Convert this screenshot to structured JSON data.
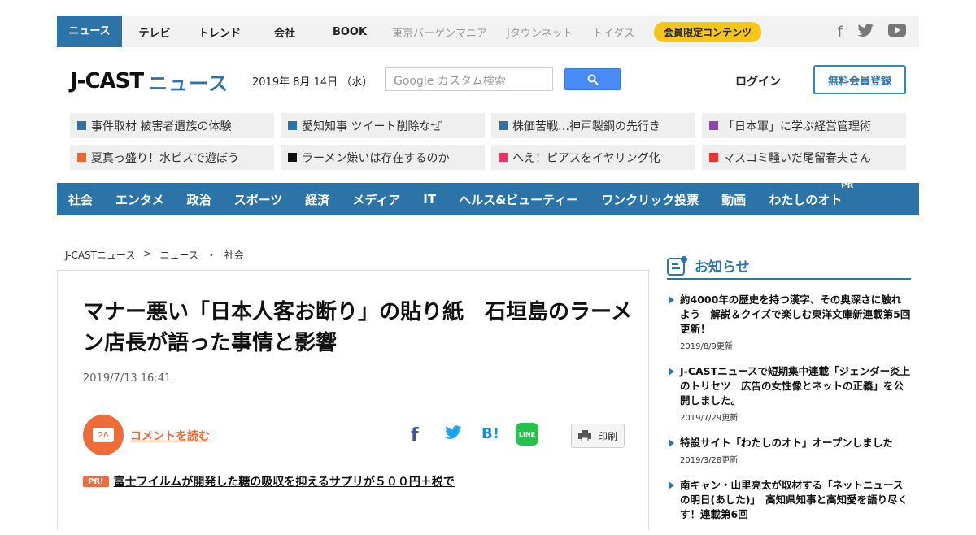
{
  "topnav": {
    "items": [
      {
        "label": "ニュース",
        "style": "active"
      },
      {
        "label": "テレビ",
        "style": "plain"
      },
      {
        "label": "トレンド",
        "style": "plain"
      },
      {
        "label": "会社",
        "style": "plain"
      },
      {
        "label": "BOOK",
        "style": "book"
      },
      {
        "label": "東京バーゲンマニア",
        "style": "gray"
      },
      {
        "label": "Jタウンネット",
        "style": "gray"
      },
      {
        "label": "トイダス",
        "style": "gray"
      }
    ],
    "member_badge": "会員限定コンテンツ",
    "social": [
      {
        "icon": "facebook-icon",
        "glyph": "f"
      },
      {
        "icon": "twitter-icon",
        "glyph": "🐦"
      },
      {
        "icon": "youtube-icon",
        "glyph": "▶"
      }
    ]
  },
  "header": {
    "logo_jcast": "J-CAST",
    "logo_news": "ニュース",
    "date": "2019年 8月 14日 （水）",
    "search_placeholder": "Google カスタム検索",
    "login_label": "ログイン",
    "register_label": "無料会員登録"
  },
  "topics": [
    {
      "label": "事件取材 被害者遺族の体験",
      "color": "#2c74a8"
    },
    {
      "label": "愛知知事 ツイート削除なぜ",
      "color": "#2c74a8"
    },
    {
      "label": "株価苦戦…神戸製鋼の先行き",
      "color": "#2c74a8"
    },
    {
      "label": "「日本軍」に学ぶ経営管理術",
      "color": "#8e44ad"
    },
    {
      "label": "夏真っ盛り！水ピスで遊ぼう",
      "color": "#f0662e"
    },
    {
      "label": "ラーメン嫌いは存在するのか",
      "color": "#111111"
    },
    {
      "label": "へえ！ピアスをイヤリング化",
      "color": "#e8336b"
    },
    {
      "label": "マスコミ騒いだ尾留春夫さん",
      "color": "#e8332e"
    }
  ],
  "categories": [
    {
      "label": "社会",
      "pr": false
    },
    {
      "label": "エンタメ",
      "pr": false
    },
    {
      "label": "政治",
      "pr": false
    },
    {
      "label": "スポーツ",
      "pr": false
    },
    {
      "label": "経済",
      "pr": false
    },
    {
      "label": "メディア",
      "pr": false
    },
    {
      "label": "IT",
      "pr": false
    },
    {
      "label": "ヘルス&ビューティー",
      "pr": false
    },
    {
      "label": "ワンクリック投票",
      "pr": false
    },
    {
      "label": "動画",
      "pr": false
    },
    {
      "label": "わたしのオト",
      "pr": true
    }
  ],
  "pr_tag": "PR",
  "breadcrumb": {
    "home": "J-CASTニュース",
    "sep1": ">",
    "section": "ニュース",
    "sep2": "・",
    "category": "社会"
  },
  "article": {
    "headline": "マナー悪い「日本人客お断り」の貼り紙　石垣島のラーメン店長が語った事情と影響",
    "date": "2019/7/13 16:41",
    "comment_count": "26",
    "comment_label": "コメントを読む",
    "share": {
      "facebook": "f",
      "hatena": "B!",
      "line": "LINE"
    },
    "print_label": "印刷",
    "pr_badge": "PR!",
    "pr_link": "富士フイルムが開発した糖の吸収を抑えるサプリが５００円＋税で"
  },
  "sidebar": {
    "title": "お知らせ",
    "items": [
      {
        "text": "約4000年の歴史を持つ漢字、その奥深さに触れよう　解説＆クイズで楽しむ東洋文庫新連載第5回更新！",
        "date": "2019/8/9更新"
      },
      {
        "text": "J-CASTニュースで短期集中連載「ジェンダー炎上のトリセツ　広告の女性像とネットの正義」を公開しました。",
        "date": "2019/7/29更新"
      },
      {
        "text": "特設サイト「わたしのオト」オープンしました",
        "date": "2019/3/28更新"
      },
      {
        "text": "南キャン・山里亮太が取材する「ネットニュースの明日(あした)」　高知県知事と高知愛を語り尽くす！連載第6回",
        "date": ""
      }
    ]
  }
}
